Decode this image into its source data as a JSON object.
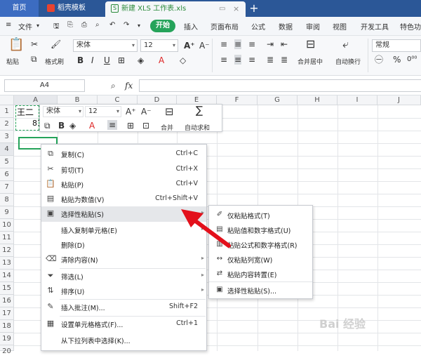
{
  "tabs": {
    "home": "首页",
    "template": "稻壳模板",
    "active_file": "新建 XLS 工作表.xls",
    "plus": "+"
  },
  "menubar": {
    "file": "文件",
    "start": "开始",
    "items": [
      "插入",
      "页面布局",
      "公式",
      "数据",
      "审阅",
      "视图",
      "开发工具",
      "特色功"
    ]
  },
  "ribbon": {
    "paste": "粘贴",
    "format_painter": "格式刷",
    "font_name": "宋体",
    "font_size": "12",
    "merge_center": "合并居中",
    "auto_wrap": "自动换行",
    "number_format": "常规",
    "percent": "%",
    "zeros": "0⁰⁰"
  },
  "formula_bar": {
    "cell_ref": "A4",
    "fx": "fx"
  },
  "columns": [
    "A",
    "B",
    "C",
    "D",
    "E",
    "F",
    "G",
    "H",
    "I",
    "J"
  ],
  "rows": [
    "1",
    "2",
    "3",
    "4",
    "5",
    "6",
    "7",
    "8",
    "9",
    "10",
    "11",
    "12",
    "13",
    "14",
    "15",
    "16",
    "17",
    "18",
    "19",
    "20"
  ],
  "cells": {
    "a1": "王二",
    "a2": "81"
  },
  "mini_toolbar": {
    "font_name": "宋体",
    "font_size": "12",
    "merge": "合并",
    "auto_sum": "自动求和"
  },
  "context_menu": [
    {
      "icon": "copy-icon",
      "glyph": "⧉",
      "label": "复制(C)",
      "shortcut": "Ctrl+C"
    },
    {
      "icon": "scissors-icon",
      "glyph": "✂",
      "label": "剪切(T)",
      "shortcut": "Ctrl+X"
    },
    {
      "icon": "paste-icon",
      "glyph": "📋",
      "label": "粘贴(P)",
      "shortcut": "Ctrl+V"
    },
    {
      "icon": "paste-values-icon",
      "glyph": "▤",
      "label": "粘贴为数值(V)",
      "shortcut": "Ctrl+Shift+V"
    },
    {
      "icon": "paste-special-icon",
      "glyph": "▣",
      "label": "选择性粘贴(S)",
      "shortcut": ""
    },
    {
      "icon": "",
      "glyph": "",
      "label": "插入复制单元格(E)",
      "shortcut": ""
    },
    {
      "icon": "",
      "glyph": "",
      "label": "删除(D)",
      "shortcut": ""
    },
    {
      "icon": "eraser-icon",
      "glyph": "⌫",
      "label": "清除内容(N)",
      "shortcut": ""
    },
    {
      "icon": "filter-icon",
      "glyph": "⏷",
      "label": "筛选(L)",
      "shortcut": ""
    },
    {
      "icon": "sort-icon",
      "glyph": "⇅",
      "label": "排序(U)",
      "shortcut": ""
    },
    {
      "icon": "comment-icon",
      "glyph": "✎",
      "label": "插入批注(M)...",
      "shortcut": "Shift+F2"
    },
    {
      "icon": "format-cells-icon",
      "glyph": "▦",
      "label": "设置单元格格式(F)...",
      "shortcut": "Ctrl+1"
    },
    {
      "icon": "",
      "glyph": "",
      "label": "从下拉列表中选择(K)...",
      "shortcut": ""
    }
  ],
  "submenu": [
    {
      "icon": "paste-format-icon",
      "glyph": "✐",
      "label": "仅粘贴格式(T)"
    },
    {
      "icon": "paste-value-number-icon",
      "glyph": "▤",
      "label": "粘贴值和数字格式(U)"
    },
    {
      "icon": "paste-formula-icon",
      "glyph": "▥",
      "label": "粘贴公式和数字格式(R)"
    },
    {
      "icon": "paste-colwidth-icon",
      "glyph": "↔",
      "label": "仅粘贴列宽(W)"
    },
    {
      "icon": "transpose-icon",
      "glyph": "⇄",
      "label": "粘贴内容转置(E)"
    },
    {
      "icon": "paste-special-icon",
      "glyph": "▣",
      "label": "选择性粘贴(S)..."
    }
  ],
  "watermark": "Bai 经验",
  "colors": {
    "tabbar": "#2b5797",
    "accent_green": "#25a35a",
    "arrow": "#e3101b"
  }
}
